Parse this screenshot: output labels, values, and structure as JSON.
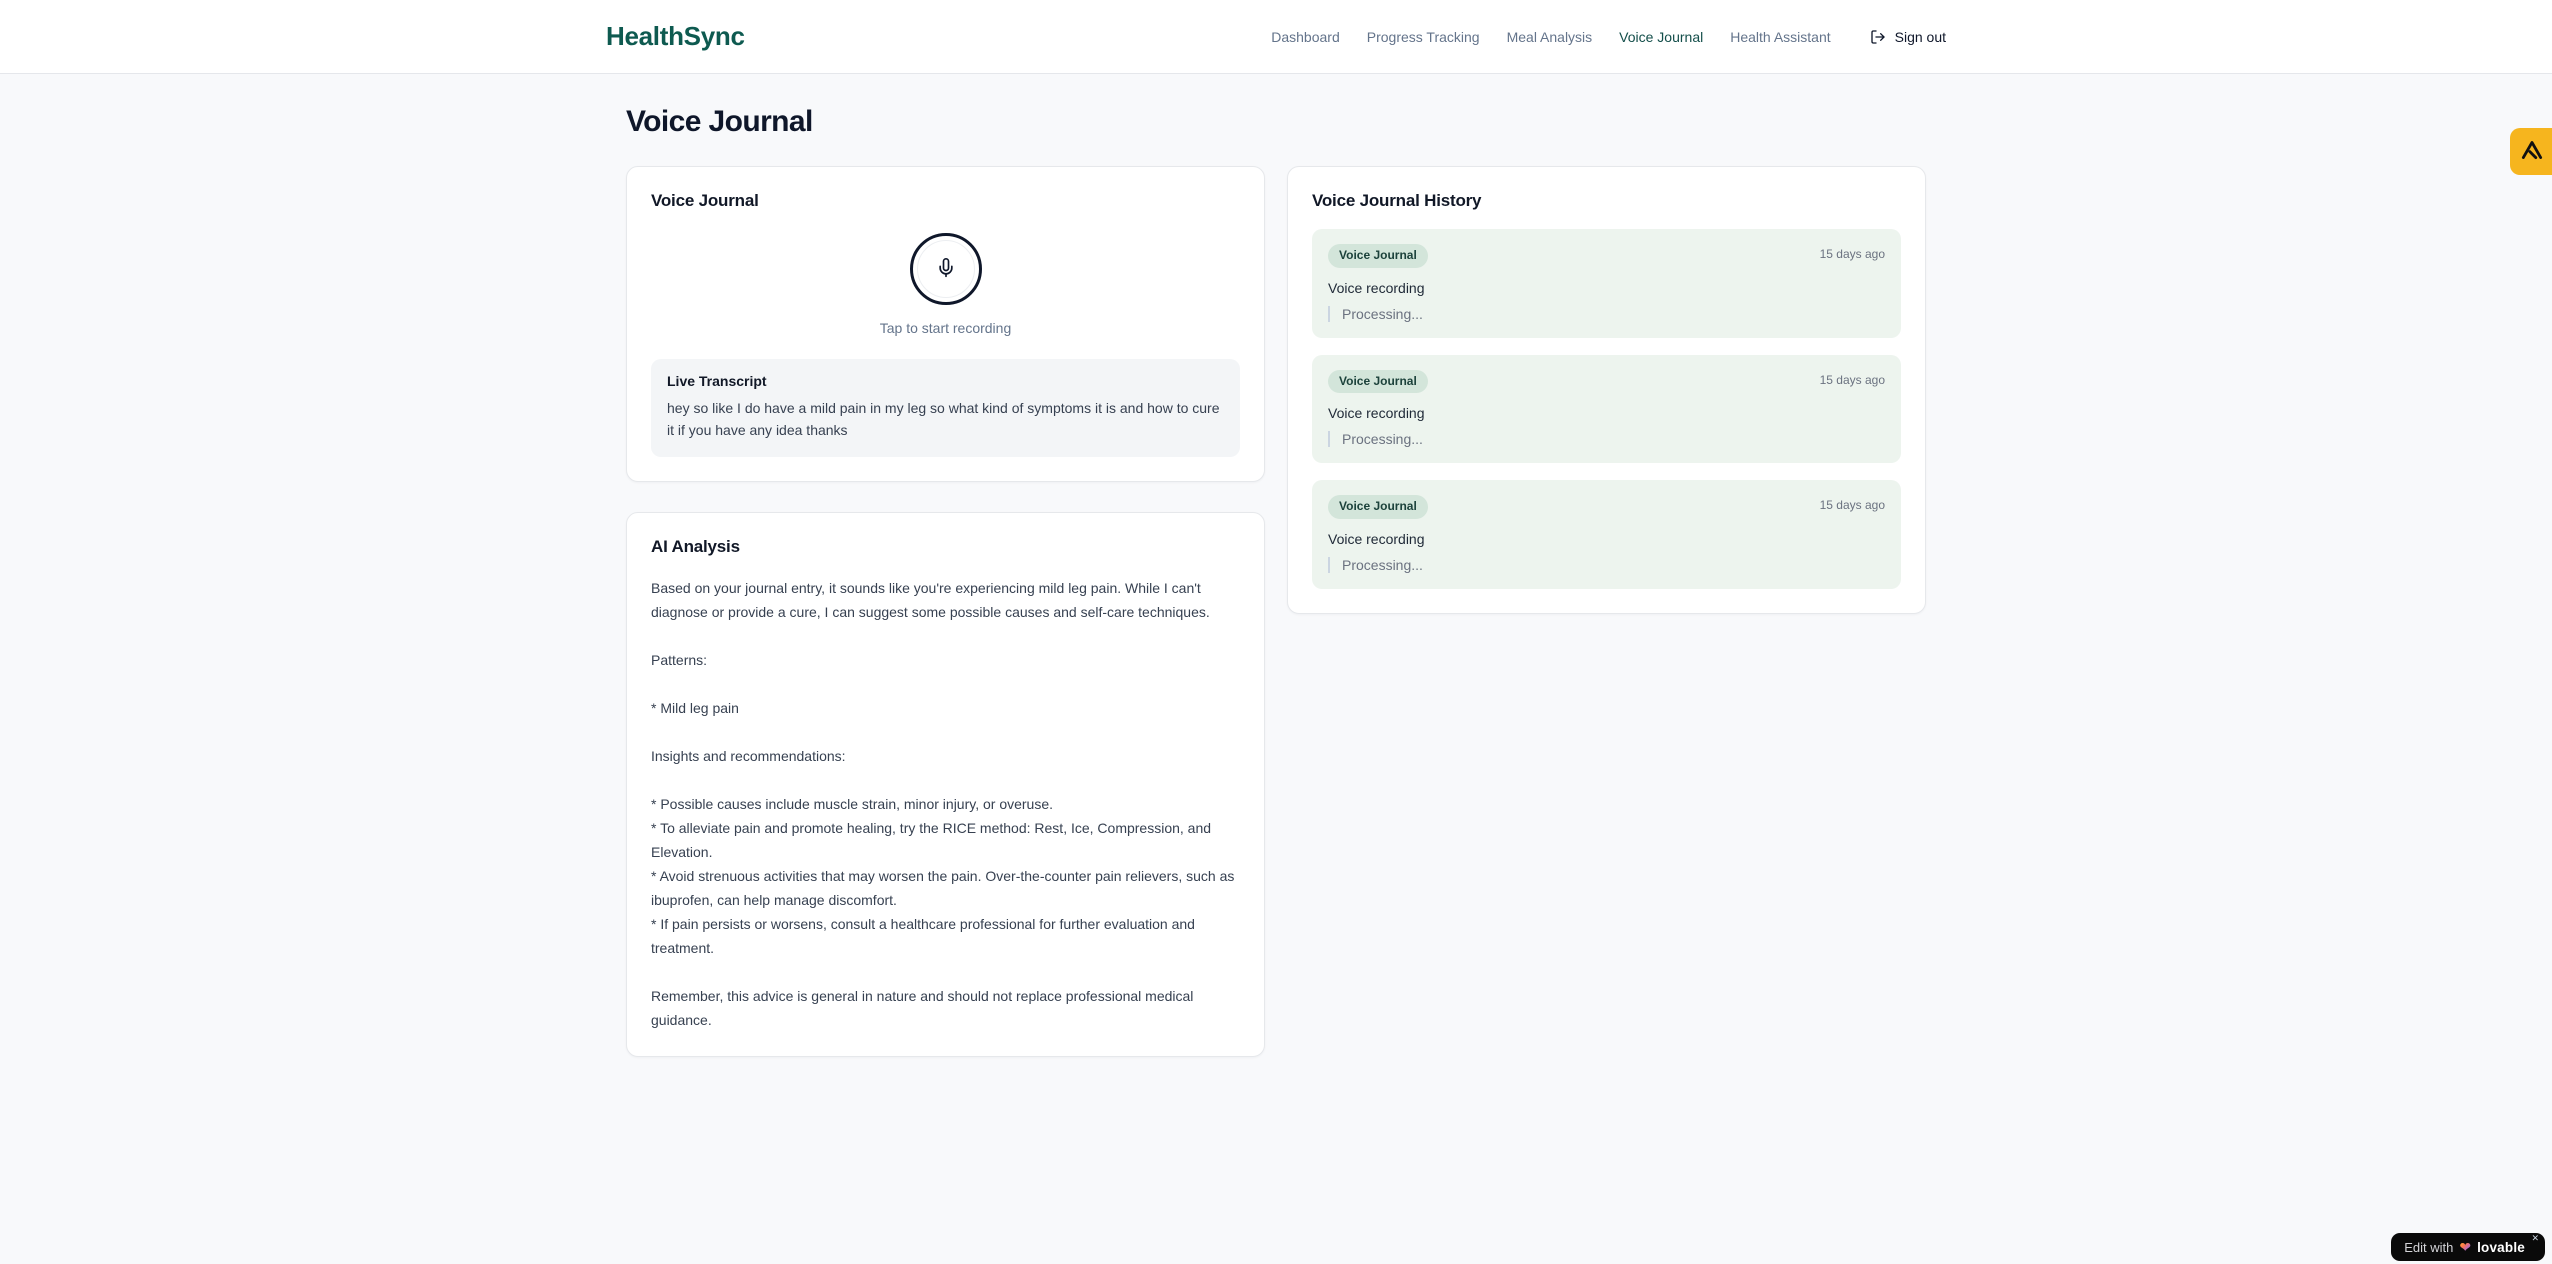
{
  "brand": {
    "name": "HealthSync"
  },
  "nav": {
    "items": [
      {
        "label": "Dashboard",
        "active": false
      },
      {
        "label": "Progress Tracking",
        "active": false
      },
      {
        "label": "Meal Analysis",
        "active": false
      },
      {
        "label": "Voice Journal",
        "active": true
      },
      {
        "label": "Health Assistant",
        "active": false
      }
    ],
    "sign_out_label": "Sign out"
  },
  "page": {
    "title": "Voice Journal"
  },
  "recorder_card": {
    "title": "Voice Journal",
    "tap_hint": "Tap to start recording",
    "live_transcript_label": "Live Transcript",
    "transcript": "hey so like I do have a mild pain in my leg so what kind of symptoms it is and how to cure it if you have any idea thanks"
  },
  "analysis_card": {
    "title": "AI Analysis",
    "body": "Based on your journal entry, it sounds like you're experiencing mild leg pain. While I can't diagnose or provide a cure, I can suggest some possible causes and self-care techniques.\n\nPatterns:\n\n* Mild leg pain\n\nInsights and recommendations:\n\n* Possible causes include muscle strain, minor injury, or overuse.\n* To alleviate pain and promote healing, try the RICE method: Rest, Ice, Compression, and Elevation.\n* Avoid strenuous activities that may worsen the pain. Over-the-counter pain relievers, such as ibuprofen, can help manage discomfort.\n* If pain persists or worsens, consult a healthcare professional for further evaluation and treatment.\n\nRemember, this advice is general in nature and should not replace professional medical guidance."
  },
  "history_card": {
    "title": "Voice Journal History",
    "entries": [
      {
        "badge": "Voice Journal",
        "time": "15 days ago",
        "title": "Voice recording",
        "status": "Processing..."
      },
      {
        "badge": "Voice Journal",
        "time": "15 days ago",
        "title": "Voice recording",
        "status": "Processing..."
      },
      {
        "badge": "Voice Journal",
        "time": "15 days ago",
        "title": "Voice recording",
        "status": "Processing..."
      }
    ]
  },
  "edit_pill": {
    "prefix": "Edit with",
    "brand": "lovable",
    "close": "✕"
  },
  "icons": {
    "mic": "microphone-icon",
    "sign_out": "log-out-icon",
    "heart": "heart-gradient-icon",
    "edge": "lovable-edge-badge-icon"
  },
  "colors": {
    "brand_teal": "#0e5a50",
    "nav_active": "#134e4a",
    "nav_inactive": "#64748b",
    "page_bg": "#f8f9fb",
    "card_border": "#e6e8eb",
    "transcript_bg": "#f3f5f7",
    "entry_bg": "#edf4ee",
    "badge_bg": "#d3e5da",
    "badge_text": "#1c423b",
    "edge_badge_amber": "#f6b51e",
    "pill_bg": "#0a0a0a"
  }
}
